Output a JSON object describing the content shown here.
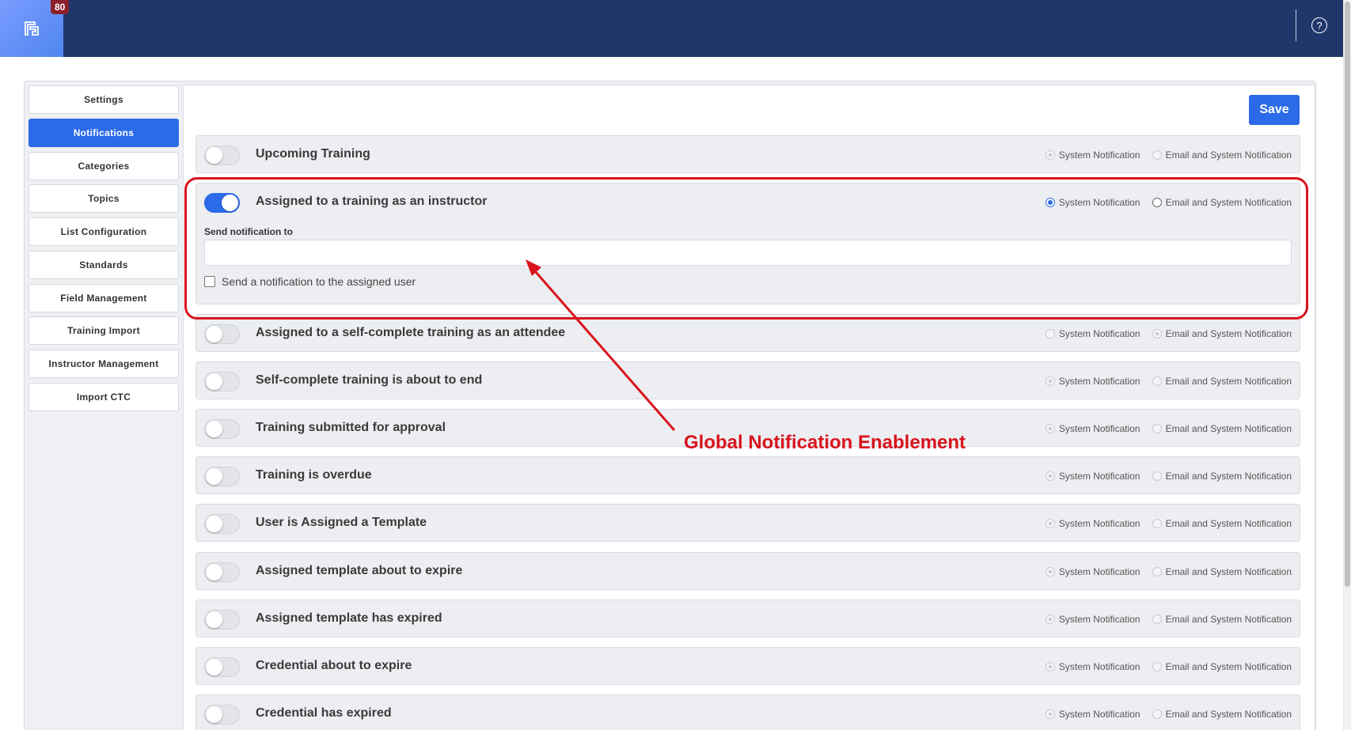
{
  "header": {
    "logo_icon": "form-logo-icon",
    "badge_count": "80",
    "help_icon": "?"
  },
  "sidebar": {
    "items": [
      {
        "label": "Settings"
      },
      {
        "label": "Notifications"
      },
      {
        "label": "Categories"
      },
      {
        "label": "Topics"
      },
      {
        "label": "List Configuration"
      },
      {
        "label": "Standards"
      },
      {
        "label": "Field Management"
      },
      {
        "label": "Training Import"
      },
      {
        "label": "Instructor Management"
      },
      {
        "label": "Import CTC"
      }
    ],
    "active_item": "Notifications"
  },
  "toolbar": {
    "save_label": "Save"
  },
  "notifications": {
    "option_system": "System Notification",
    "option_email": "Email and System Notification",
    "rows": [
      {
        "label": "Upcoming Training",
        "enabled": false,
        "selected": "system"
      },
      {
        "label": "Assigned to a training as an instructor",
        "enabled": true,
        "selected": "system"
      },
      {
        "label": "Assigned to a self-complete training as an attendee",
        "enabled": false,
        "selected": "email"
      },
      {
        "label": "Self-complete training is about to end",
        "enabled": false,
        "selected": "system"
      },
      {
        "label": "Training submitted for approval",
        "enabled": false,
        "selected": "system"
      },
      {
        "label": "Training is overdue",
        "enabled": false,
        "selected": "system"
      },
      {
        "label": "User is Assigned a Template",
        "enabled": false,
        "selected": "system"
      },
      {
        "label": "Assigned template about to expire",
        "enabled": false,
        "selected": "system"
      },
      {
        "label": "Assigned template has expired",
        "enabled": false,
        "selected": "system"
      },
      {
        "label": "Credential about to expire",
        "enabled": false,
        "selected": "system"
      },
      {
        "label": "Credential has expired",
        "enabled": false,
        "selected": "system"
      }
    ],
    "expanded": {
      "send_to_label": "Send notification to",
      "send_to_value": "",
      "assigned_user_checkbox_label": "Send a notification to the assigned user",
      "assigned_user_checked": false
    }
  },
  "annotation": {
    "text": "Global Notification Enablement",
    "color": "#d9141d"
  },
  "colors": {
    "topbar": "#1f376b",
    "accent": "#2c6be8"
  }
}
